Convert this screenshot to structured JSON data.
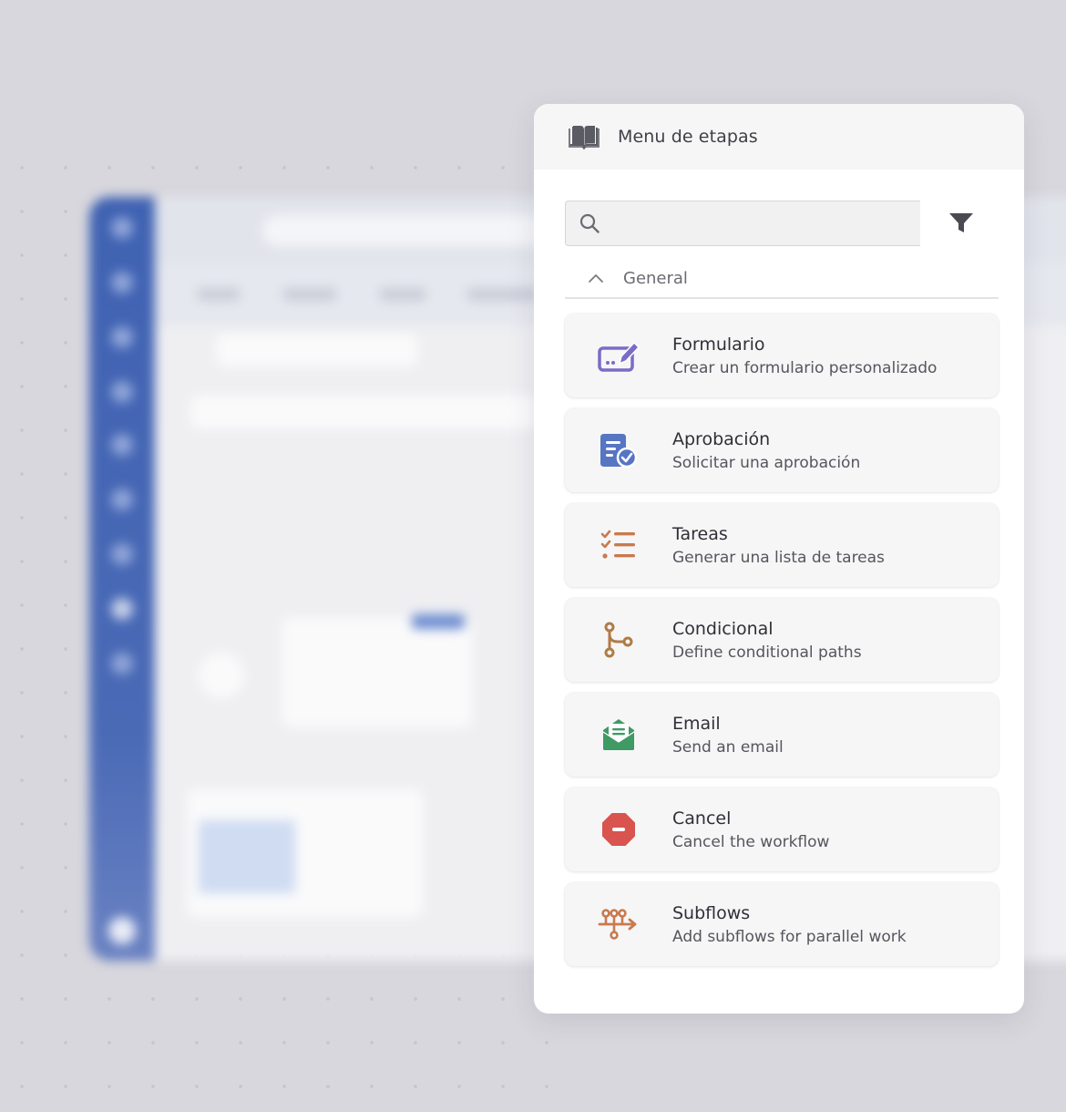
{
  "panel": {
    "title": "Menu de etapas",
    "search": {
      "value": "",
      "placeholder": ""
    },
    "section": {
      "label": "General",
      "expanded": true
    },
    "items": [
      {
        "title": "Formulario",
        "description": "Crear un formulario personalizado",
        "icon": "form-edit-icon",
        "color": "#7a6cc6"
      },
      {
        "title": "Aprobación",
        "description": "Solicitar una aprobación",
        "icon": "approval-document-icon",
        "color": "#5675c3"
      },
      {
        "title": "Tareas",
        "description": "Generar una lista de tareas",
        "icon": "checklist-icon",
        "color": "#c97a4e"
      },
      {
        "title": "Condicional",
        "description": "Define conditional paths",
        "icon": "branch-icon",
        "color": "#b07c45"
      },
      {
        "title": "Email",
        "description": "Send an email",
        "icon": "email-open-icon",
        "color": "#3f9a63"
      },
      {
        "title": "Cancel",
        "description": "Cancel the workflow",
        "icon": "stop-octagon-icon",
        "color": "#d9534f"
      },
      {
        "title": "Subflows",
        "description": "Add subflows for parallel work",
        "icon": "subflow-icon",
        "color": "#c97a4e"
      }
    ]
  },
  "colors": {
    "page_bg": "#d8d7dd",
    "panel_bg": "#ffffff",
    "header_bg": "#f6f6f7",
    "sidebar_blue": "#4a6ab6"
  }
}
